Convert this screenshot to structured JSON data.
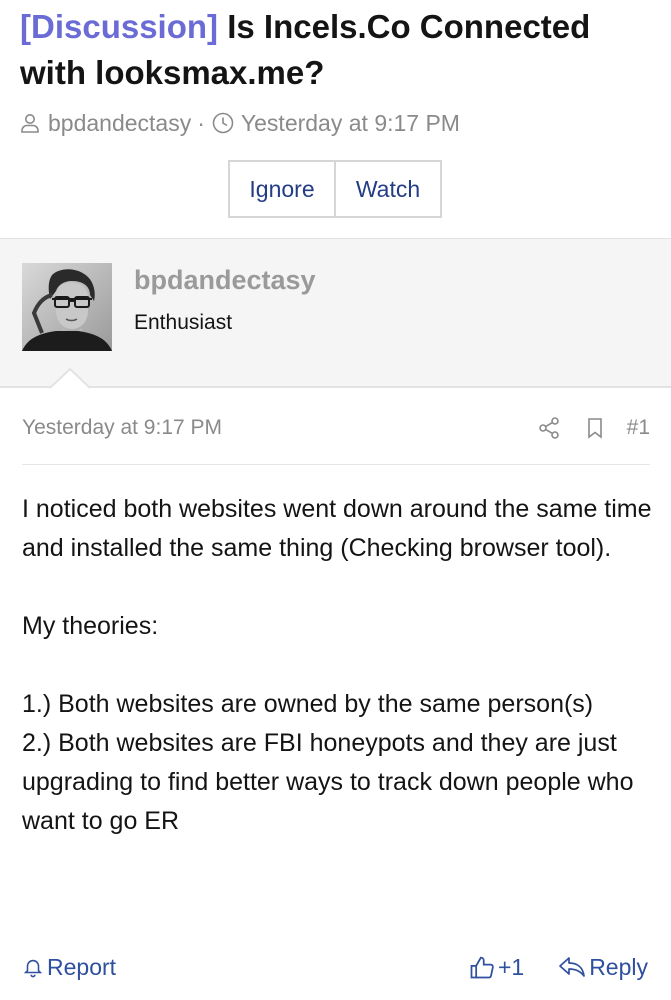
{
  "thread": {
    "prefix": "[Discussion]",
    "title": "Is Incels.Co Connected with looksmax.me?",
    "author": "bpdandectasy",
    "separator": "·",
    "date": "Yesterday at 9:17 PM",
    "ignore_label": "Ignore",
    "watch_label": "Watch"
  },
  "user": {
    "name": "bpdandectasy",
    "title": "Enthusiast"
  },
  "post": {
    "date": "Yesterday at 9:17 PM",
    "number": "#1",
    "paragraphs": [
      "I noticed both websites went down around the same time and installed the same thing (Checking browser tool).",
      "My theories:",
      "1.) Both websites are owned by the same person(s)",
      "2.) Both websites are FBI honeypots and they are just upgrading to find better ways to track down people who want to go ER"
    ],
    "report_label": "Report",
    "like_label": "+1",
    "reply_label": "Reply"
  },
  "icons": {
    "author": "user-icon",
    "time": "clock-icon",
    "share": "share-icon",
    "bookmark": "bookmark-icon",
    "report": "bell-icon",
    "like": "thumbs-up-icon",
    "reply": "reply-icon"
  },
  "colors": {
    "prefix": "#6b6bd6",
    "link": "#2f4f9f",
    "button_text": "#233c85",
    "muted": "#8a8a8a",
    "panel_bg": "#f5f5f5"
  }
}
